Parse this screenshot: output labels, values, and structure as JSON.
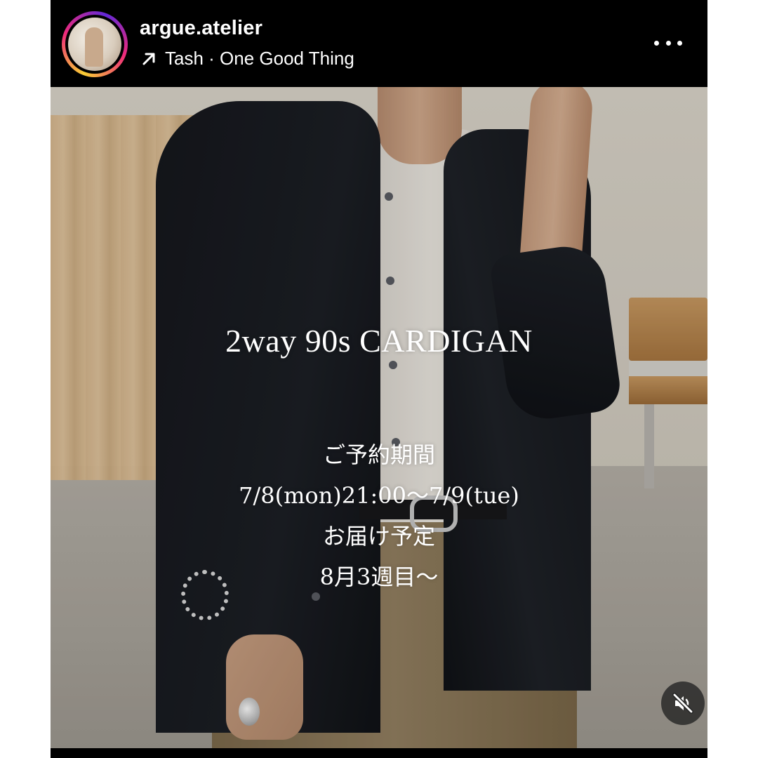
{
  "post": {
    "username": "argue.atelier",
    "audio_arrow": "↗",
    "audio_label": "Tash · One Good Thing",
    "more_icon": "more-horizontal-icon",
    "mute_icon": "speaker-muted-icon"
  },
  "overlay": {
    "headline": "2way 90s CARDIGAN",
    "lines": [
      "ご予約期間",
      "7/8(mon)21:00～7/9(tue)",
      "お届け予定",
      "8月3週目～"
    ]
  },
  "colors": {
    "background": "#000000",
    "text": "#ffffff",
    "story_ring": [
      "#f9ce34",
      "#ee2a7b",
      "#6228d7"
    ]
  }
}
